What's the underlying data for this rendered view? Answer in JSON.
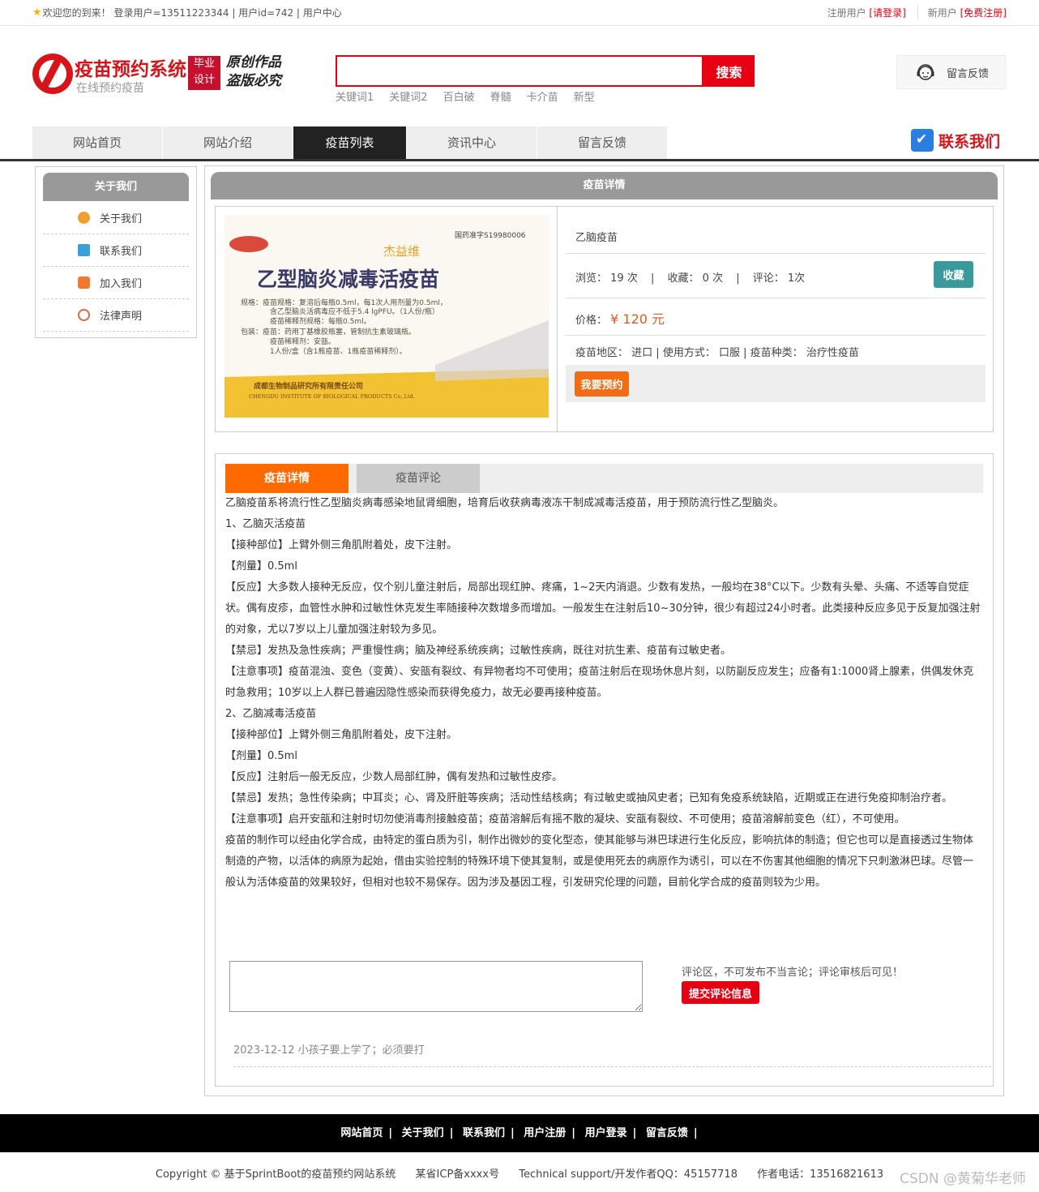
{
  "topbar": {
    "welcome": "欢迎您的到来！ 登录用户=13511223344 | 用户id=742 | 用户中心",
    "reg_label": "注册用户",
    "login_link": "[请登录]",
    "new_label": "新用户",
    "register_link": "[免费注册]"
  },
  "header": {
    "title": "疫苗预约系统",
    "subtitle": "在线预约疫苗",
    "badge_line1": "毕业",
    "badge_line2": "设计",
    "slogan_line1": "原创作品",
    "slogan_line2": "盗版必究",
    "search_placeholder": "",
    "search_button": "搜索",
    "keywords": [
      "关键词1",
      "关键词2",
      "百白破",
      "脊髓",
      "卡介苗",
      "新型"
    ],
    "feedback_button": "留言反馈"
  },
  "nav": {
    "items": [
      "网站首页",
      "网站介绍",
      "疫苗列表",
      "资讯中心",
      "留言反馈"
    ],
    "active_index": 2,
    "contact": "联系我们"
  },
  "sidebar": {
    "title": "关于我们",
    "items": [
      {
        "label": "关于我们",
        "icon": "info-circle-icon",
        "color": "#f0a030"
      },
      {
        "label": "联系我们",
        "icon": "clipboard-icon",
        "color": "#3aa0d8"
      },
      {
        "label": "加入我们",
        "icon": "lock-icon",
        "color": "#f07a30"
      },
      {
        "label": "法律声明",
        "icon": "power-icon",
        "color": "#d86a4a"
      }
    ]
  },
  "main": {
    "title": "疫苗详情",
    "product": {
      "name": "乙脑疫苗",
      "views_label": "浏览：",
      "views": "19 次",
      "favs_label": "收藏：",
      "favs": "0 次",
      "comments_label": "评论：",
      "comments": "1次",
      "fav_button": "收藏",
      "price_label": "价格：",
      "price": "¥ 120 元",
      "region_label": "疫苗地区：",
      "region": "进口",
      "usage_label": "使用方式：",
      "usage": "口服",
      "type_label": "疫苗种类：",
      "type": "治疗性疫苗",
      "order_button": "我要预约",
      "image": {
        "approval": "国药准字S19980006",
        "brand": "杰益维",
        "name": "乙型脑炎减毒活疫苗",
        "lines": [
          "规格：疫苗规格：复溶后每瓶0.5ml，每1次人用剂量为0.5ml，",
          "含乙型脑炎活病毒应不低于5.4 lgPFU。（1人份/瓶）",
          "疫苗稀释剂规格：每瓶0.5ml。",
          "包装：疫苗：药用丁基橡胶瓶塞，管制抗生素玻璃瓶。",
          "疫苗稀释剂：安瓿。",
          "1人份/盒（含1瓶疫苗、1瓶疫苗稀释剂）。"
        ],
        "company": "成都生物制品研究所有限责任公司",
        "company_en": "CHENGDU INSTITUTE OF BIOLOGICAL PRODUCTS Co.,Ltd."
      }
    },
    "tabs": [
      "疫苗详情",
      "疫苗评论"
    ],
    "description": [
      "乙脑疫苗系将流行性乙型脑炎病毒感染地鼠肾细胞，培育后收获病毒液冻干制成减毒活疫苗，用于预防流行性乙型脑炎。",
      "1、乙脑灭活疫苗",
      "【接种部位】上臂外侧三角肌附着处，皮下注射。",
      "【剂量】0.5ml",
      "【反应】大多数人接种无反应，仅个别儿童注射后，局部出现红肿、疼痛，1~2天内消退。少数有发热，一般均在38°C以下。少数有头晕、头痛、不适等自觉症状。偶有皮疹，血管性水肿和过敏性休克发生率随接种次数增多而增加。一般发生在注射后10~30分钟，很少有超过24小时者。此类接种反应多见于反复加强注射的对象，尤以7岁以上儿童加强注射较为多见。",
      "【禁忌】发热及急性疾病；严重慢性病；脑及神经系统疾病；过敏性疾病，既往对抗生素、疫苗有过敏史者。",
      "【注意事项】疫苗混浊、变色（变黄）、安瓿有裂纹、有异物者均不可使用；疫苗注射后在现场休息片刻，以防副反应发生；应备有1:1000肾上腺素，供偶发休克时急救用；10岁以上人群已普遍因隐性感染而获得免疫力，故无必要再接种疫苗。",
      "2、乙脑减毒活疫苗",
      "【接种部位】上臂外侧三角肌附着处，皮下注射。",
      "【剂量】0.5ml",
      "【反应】注射后一般无反应，少数人局部红肿，偶有发热和过敏性皮疹。",
      "【禁忌】发热；急性传染病；中耳炎；心、肾及肝脏等疾病；活动性结核病；有过敏史或抽风史者；已知有免疫系统缺陷，近期或正在进行免疫抑制治疗者。",
      "【注意事项】启开安瓿和注射时切勿使消毒剂接触疫苗；疫苗溶解后有摇不散的凝块、安瓿有裂纹、不可使用；疫苗溶解前变色（红），不可使用。",
      "疫苗的制作可以经由化学合成，由特定的蛋白质为引，制作出微妙的变化型态，使其能够与淋巴球进行生化反应，影响抗体的制造；但它也可以是直接透过生物体制造的产物，以活体的病原为起始，借由实验控制的特殊环境下使其复制，或是使用死去的病原作为诱引，可以在不伤害其他细胞的情况下只刺激淋巴球。尽管一般认为活体疫苗的效果较好，但相对也较不易保存。因为涉及基因工程，引发研究伦理的问题，目前化学合成的疫苗则较为少用。"
    ],
    "comment_note": "评论区，不可发布不当言论；评论审核后可见！",
    "submit_button": "提交评论信息",
    "comments_list": [
      "2023-12-12 小孩子要上学了；必须要打"
    ]
  },
  "footer": {
    "links": [
      "网站首页",
      "关于我们",
      "联系我们",
      "用户注册",
      "用户登录",
      "留言反馈"
    ],
    "copyright": "Copyright © 基于SprintBoot的疫苗预约网站系统",
    "icp": "某省ICP备xxxx号",
    "support": "Technical support/开发作者QQ：45157718",
    "phone": "作者电话：13516821613",
    "watermark": "CSDN @黄菊华老师"
  }
}
